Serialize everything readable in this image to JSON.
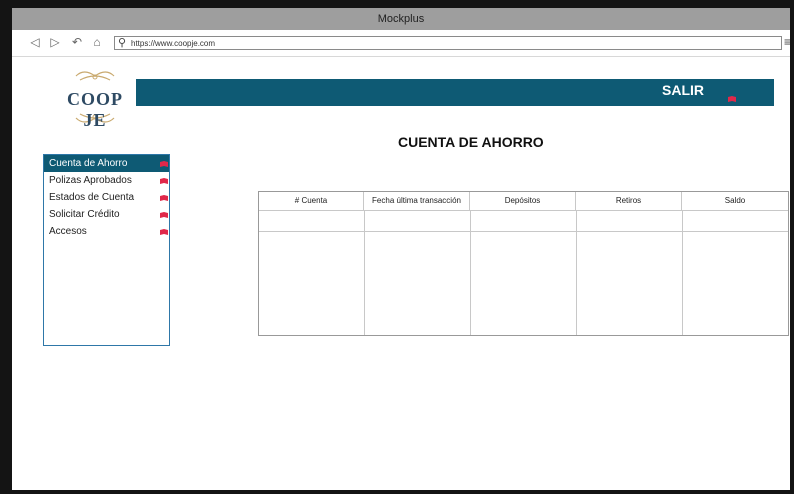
{
  "window": {
    "title": "Mockplus"
  },
  "browser": {
    "url": "https://www.coopje.com",
    "nav": [
      "back-icon",
      "forward-icon",
      "refresh-icon",
      "home-icon"
    ]
  },
  "brand": {
    "logo_text": "COOP JE",
    "color": "#2e4a63"
  },
  "header": {
    "logout_label": "SALIR",
    "bar_color": "#0e5a74"
  },
  "page": {
    "title": "CUENTA DE AHORRO"
  },
  "sidebar": {
    "items": [
      {
        "label": "Cuenta de Ahorro",
        "active": true
      },
      {
        "label": "Polizas Aprobados",
        "active": false
      },
      {
        "label": "Estados de Cuenta",
        "active": false
      },
      {
        "label": "Solicitar Crédito",
        "active": false
      },
      {
        "label": "Accesos",
        "active": false
      }
    ]
  },
  "table": {
    "columns": [
      "# Cuenta",
      "Fecha última transacción",
      "Depósitos",
      "Retiros",
      "Saldo"
    ],
    "rows": []
  }
}
